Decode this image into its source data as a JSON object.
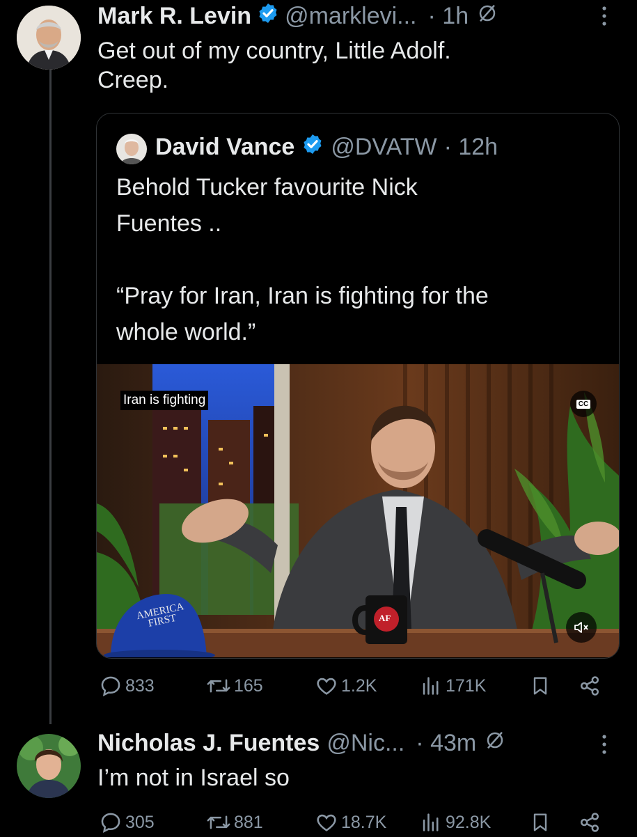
{
  "tweet1": {
    "name": "Mark R. Levin",
    "handle": "@marklevi...",
    "time": "· 1h",
    "text": "Get out of my country, Little Adolf.\n Creep."
  },
  "quote": {
    "name": "David Vance",
    "handle": "@DVATW",
    "time": "· 12h",
    "text": "Behold Tucker favourite Nick\nFuentes ..\n\n“Pray for Iran, Iran is fighting for the\nwhole world.”",
    "video": {
      "caption": "Iran is fighting",
      "cc_label": "CC",
      "hat_text": "AMERICA\nFIRST",
      "mug_text": "AF"
    }
  },
  "tweet1_actions": {
    "replies": "833",
    "reposts": "165",
    "likes": "1.2K",
    "views": "171K"
  },
  "tweet2": {
    "name": "Nicholas J. Fuentes",
    "handle": "@Nic...",
    "time": "· 43m",
    "text": "I’m not in Israel so"
  },
  "tweet2_actions": {
    "replies": "305",
    "reposts": "881",
    "likes": "18.7K",
    "views": "92.8K"
  },
  "colors": {
    "background": "#000000",
    "text": "#e7e9ea",
    "muted": "#8b98a5",
    "verified": "#1d9bf0",
    "border": "#2f3336"
  },
  "icons": [
    "verified-badge-icon",
    "grok-icon",
    "more-icon",
    "reply-icon",
    "repost-icon",
    "like-icon",
    "views-icon",
    "bookmark-icon",
    "share-icon",
    "mute-icon",
    "cc-icon"
  ]
}
